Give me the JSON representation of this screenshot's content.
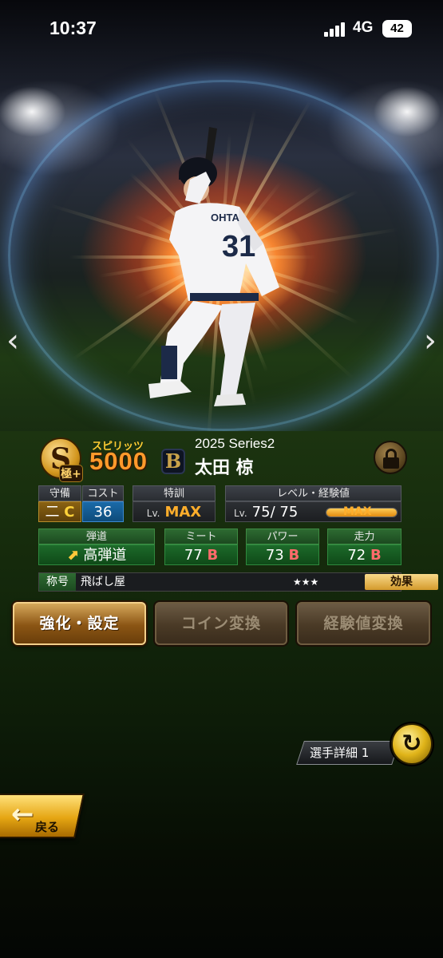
{
  "status_bar": {
    "time": "10:37",
    "network": "4G",
    "battery": "42"
  },
  "card": {
    "rank": "S",
    "rank_badge": "極+",
    "spirits_label": "スピリッツ",
    "spirits_value": "5000",
    "team_logo": "B",
    "series": "2025 Series2",
    "player_name": "太田 椋",
    "uniform_name": "OHTA",
    "uniform_number": "31"
  },
  "stats": {
    "defense_label": "守備",
    "defense_position": "二",
    "defense_grade": "C",
    "cost_label": "コスト",
    "cost_value": "36",
    "training_label": "特訓",
    "training_lv": "Lv.",
    "training_value": "MAX",
    "level_label": "レベル・経験値",
    "level_lv": "Lv.",
    "level_value": "75/ 75",
    "exp_max": "MAX",
    "exp_fill": 1.0,
    "trajectory_label": "弾道",
    "trajectory_value": "高弾道",
    "meet_label": "ミート",
    "meet_value": "77",
    "meet_grade": "B",
    "power_label": "パワー",
    "power_value": "73",
    "power_grade": "B",
    "speed_label": "走力",
    "speed_value": "72",
    "speed_grade": "B"
  },
  "title": {
    "tag": "称号",
    "name": "飛ばし屋",
    "stars": "★★★",
    "effect": "効果"
  },
  "actions": {
    "enhance": "強化・設定",
    "coin": "コイン変換",
    "exp": "経験値変換"
  },
  "nav": {
    "detail": "選手詳細 1",
    "back": "戻る"
  },
  "icons": {
    "prev": "chevron-left-icon",
    "next": "chevron-right-icon",
    "lock": "lock-icon",
    "swap": "swap-icon",
    "back": "back-arrow-icon",
    "trajectory": "arrow-up-right-icon"
  },
  "colors": {
    "accent_orange": "#ff9a2b",
    "grade_b": "#ff6b6b",
    "max": "#ffae2b",
    "position_c": "#ffd23a"
  }
}
